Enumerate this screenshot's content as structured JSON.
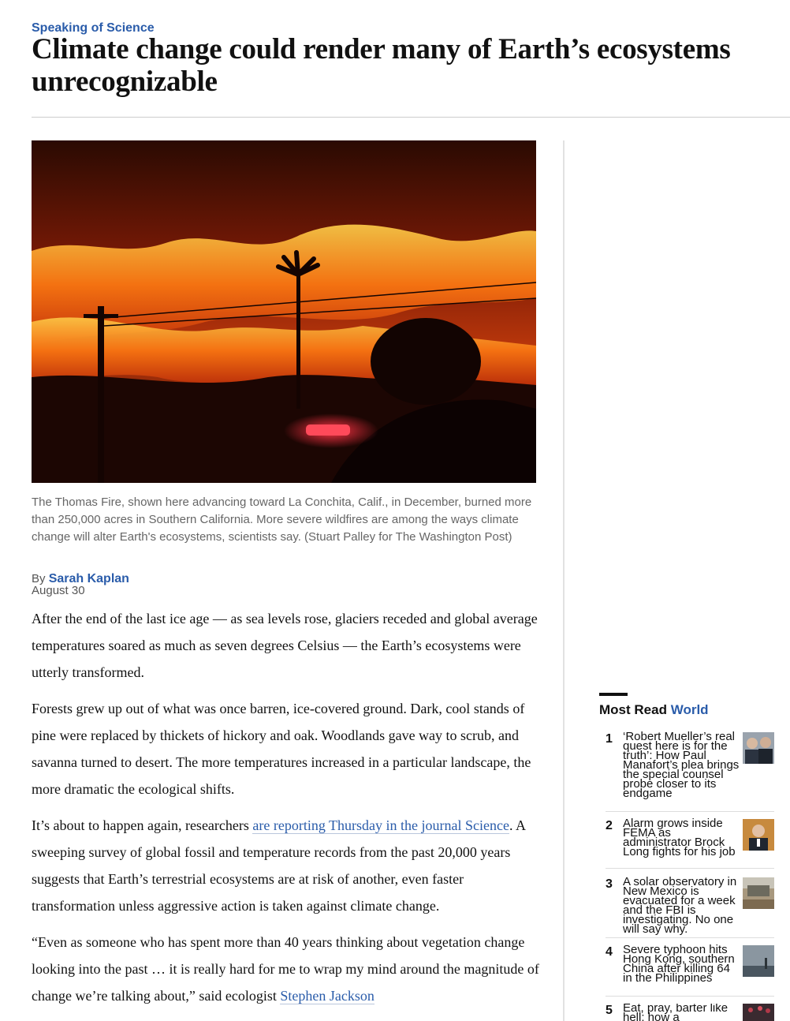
{
  "article": {
    "kicker": "Speaking of Science",
    "headline": "Climate change could render many of Earth’s ecosystems unrecognizable",
    "photo_caption": "The Thomas Fire, shown here advancing toward La Conchita, Calif., in December, burned more than 250,000 acres in Southern California. More severe wildfires are among the ways climate change will alter Earth's ecosystems, scientists say. (Stuart Palley for The Washington Post)",
    "byline_prefix": "By",
    "author": "Sarah Kaplan",
    "date": "August 30",
    "p1": "After the end of the last ice age — as sea levels rose, glaciers receded and global average temperatures soared as much as seven degrees Celsius — the Earth’s ecosystems were utterly transformed.",
    "p2": "Forests grew up out of what was once barren, ice-covered ground. Dark, cool stands of pine were replaced by thickets of hickory and oak. Woodlands gave way to scrub, and savanna turned to desert. The more temperatures increased in a particular landscape, the more dramatic the ecological shifts.",
    "p3_pre": "It’s about to happen again, researchers ",
    "p3_link": "are reporting Thursday in the journal Science",
    "p3_post": ". A sweeping survey of global fossil and temperature records from the past 20,000 years suggests that Earth’s terrestrial ecosystems are at risk of another, even faster transformation unless aggressive action is taken against climate change.",
    "p4_pre": "“Even as someone who has spent more than 40 years thinking about vegetation change looking into the past … it is really hard for me to wrap my mind around the magnitude of change we’re talking about,” said ecologist ",
    "p4_link": "Stephen Jackson"
  },
  "most_read": {
    "title": "Most Read",
    "section": "World",
    "items": [
      {
        "num": "1",
        "headline": "‘Robert Mueller’s real quest here is for the truth’: How Paul Manafort’s plea brings the special counsel probe closer to its endgame",
        "thumb": "thumb-portraits"
      },
      {
        "num": "2",
        "headline": "Alarm grows inside FEMA as administrator Brock Long fights for his job",
        "thumb": "thumb-portrait"
      },
      {
        "num": "3",
        "headline": "A solar observatory in New Mexico is evacuated for a week and the FBI is investigating. No one will say why.",
        "thumb": "thumb-sign"
      },
      {
        "num": "4",
        "headline": "Severe typhoon hits Hong Kong, southern China after killing 64 in the Philippines",
        "thumb": "thumb-storm"
      },
      {
        "num": "5",
        "headline": "Eat, pray, barter like hell: how a",
        "thumb": "thumb-crowd"
      }
    ]
  },
  "colors": {
    "link": "#2a5caa",
    "text": "#111111",
    "caption": "#666666"
  }
}
